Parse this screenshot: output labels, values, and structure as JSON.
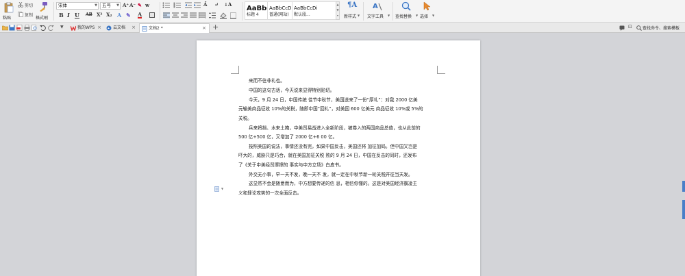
{
  "ribbon": {
    "paste": "粘贴",
    "cut": "剪切",
    "copy": "复制",
    "format_painter": "格式刷",
    "font_name": "宋体",
    "font_size": "五号",
    "styles": [
      {
        "preview": "AaBbC",
        "name": "标题 4"
      },
      {
        "preview": "AaBbCcD",
        "name": "普通(网站)"
      },
      {
        "preview": "AaBbCcDi",
        "name": "默认段..."
      }
    ],
    "new_style": "新样式",
    "text_tools": "文字工具",
    "find_replace": "查找替换",
    "select": "选择"
  },
  "tabbar": {
    "tabs": [
      {
        "label": "我的WPS",
        "close": "×"
      },
      {
        "label": "云文档",
        "close": "×"
      },
      {
        "label": "文档2 *",
        "close": "×"
      }
    ],
    "new_tab": "+",
    "search": "查找命令、搜索模板"
  },
  "document": {
    "paragraphs": [
      "来而不往非礼也。",
      "中国的这句古话，今天说来显得特别贴切。",
      "今天，9 月 24 日，中国传统   佳节中秋节，美国送来了一份“厚礼”：对我 2000 亿美",
      "元输美商品征收 10%的关税，随即中国“回礼”，对美国 600 亿美元  商品征收 10%或 5%的",
      "关税。",
      "兵来将挡、水来土掩，中美贸易战进入全新阶段，被卷入的两国商品总值，也从此前的",
      "500 亿+500 亿，又增加了 2000 亿+6    00 亿。",
      "按照美国的说法，事情还没有完，如果中国反击，美国还将 加征加码。但中国又岂是",
      "吓大的，威胁只是巧合，就在美国加征关税   败的 9 月 24 日，中国在反击的同时，还发布",
      "了《关于中美经贸摩擦的 事实与中方立场》白皮书。",
      "外交无小事，早一天不发，晚一天不 发，就一定在中秋节新一轮关税开征当天发。",
      "这显然不会是随意而为，中方想要传递的信 息，相信你懂的。这是对美国经济霸凌主",
      "义和肆论攻势的一次全面反击。"
    ]
  },
  "colors": {
    "accent": "#4a7fc8",
    "page_bg": "#ffffff",
    "workspace_bg": "#d3d4d8"
  }
}
